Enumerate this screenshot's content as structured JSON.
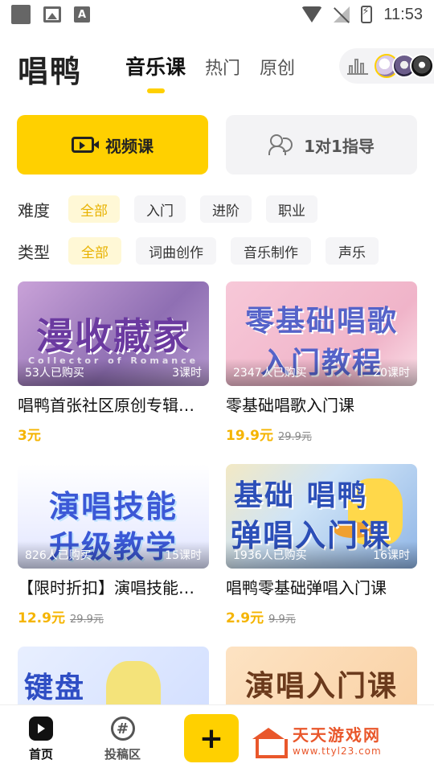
{
  "status_bar": {
    "time": "11:53",
    "a_icon": "A"
  },
  "header": {
    "logo": "唱鸭",
    "tabs": [
      {
        "label": "音乐课",
        "active": true
      },
      {
        "label": "热门",
        "active": false
      },
      {
        "label": "原创",
        "active": false
      }
    ]
  },
  "categories": [
    {
      "label": "视频课",
      "icon": "video-icon",
      "active": true
    },
    {
      "label": "1对1指导",
      "icon": "users-icon",
      "active": false
    }
  ],
  "filters": {
    "level": {
      "label": "难度",
      "options": [
        "全部",
        "入门",
        "进阶",
        "职业"
      ],
      "selected": "全部"
    },
    "type": {
      "label": "类型",
      "options": [
        "全部",
        "词曲创作",
        "音乐制作",
        "声乐"
      ],
      "selected": "全部"
    }
  },
  "courses": [
    {
      "thumb_line1": "漫收藏家",
      "thumb_line2": "Collector of Romance",
      "buyers": "53人已购买",
      "lessons": "3课时",
      "title": "唱鸭首张社区原创专辑…",
      "price": "3元",
      "original_price": ""
    },
    {
      "thumb_line1": "零基础唱歌",
      "thumb_line2": "入门教程",
      "buyers": "2347人已购买",
      "lessons": "20课时",
      "title": "零基础唱歌入门课",
      "price": "19.9元",
      "original_price": "29.9元"
    },
    {
      "thumb_line1": "演唱技能",
      "thumb_line2": "升级教学",
      "buyers": "826人已购买",
      "lessons": "15课时",
      "title": "【限时折扣】演唱技能…",
      "price": "12.9元",
      "original_price": "29.9元"
    },
    {
      "thumb_line1": "基础 唱鸭",
      "thumb_line2": "弹唱入门课",
      "buyers": "1936人已购买",
      "lessons": "16课时",
      "title": "唱鸭零基础弹唱入门课",
      "price": "2.9元",
      "original_price": "9.9元"
    },
    {
      "thumb_line1": "键盘",
      "thumb_line2": "",
      "buyers": "",
      "lessons": "",
      "title": "",
      "price": "",
      "original_price": ""
    },
    {
      "thumb_line1": "演唱入门课",
      "thumb_line2": "",
      "buyers": "",
      "lessons": "",
      "title": "",
      "price": "",
      "original_price": ""
    }
  ],
  "bottom_nav": {
    "items": [
      {
        "label": "首页",
        "icon": "home-icon",
        "active": true
      },
      {
        "label": "投稿区",
        "icon": "hashtag-icon",
        "active": false
      }
    ],
    "plus_label": "+",
    "hash_glyph": "#"
  },
  "watermark": {
    "name": "天天游戏网",
    "url": "www.ttyl23.com"
  },
  "colors": {
    "accent": "#ffd000",
    "price": "#f5b400",
    "chip_active_bg": "#fff8d6",
    "watermark": "#e9572b"
  }
}
